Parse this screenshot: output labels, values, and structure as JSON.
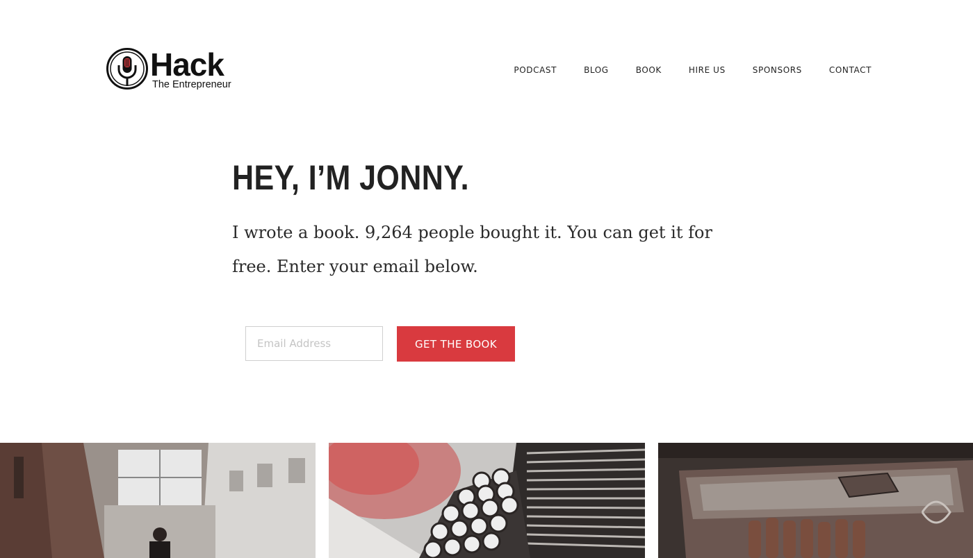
{
  "header": {
    "logo": {
      "word": "Hack",
      "tagline": "The Entrepreneur",
      "icon": "microphone-circle-icon"
    },
    "nav": [
      {
        "label": "PODCAST"
      },
      {
        "label": "BLOG"
      },
      {
        "label": "BOOK"
      },
      {
        "label": "HIRE US"
      },
      {
        "label": "SPONSORS"
      },
      {
        "label": "CONTACT"
      }
    ]
  },
  "hero": {
    "headline": "HEY, I’M JONNY.",
    "intro": "I wrote a book. 9,264 people bought it. You can get it for free. Enter your email below.",
    "email_placeholder": "Email Address",
    "email_value": "",
    "cta_label": "GET THE BOOK"
  },
  "photos": [
    {
      "name": "alley-photo"
    },
    {
      "name": "typewriter-photo"
    },
    {
      "name": "tools-photo"
    }
  ],
  "colors": {
    "accent": "#d93a3f",
    "text": "#222222",
    "background": "#ffffff"
  }
}
